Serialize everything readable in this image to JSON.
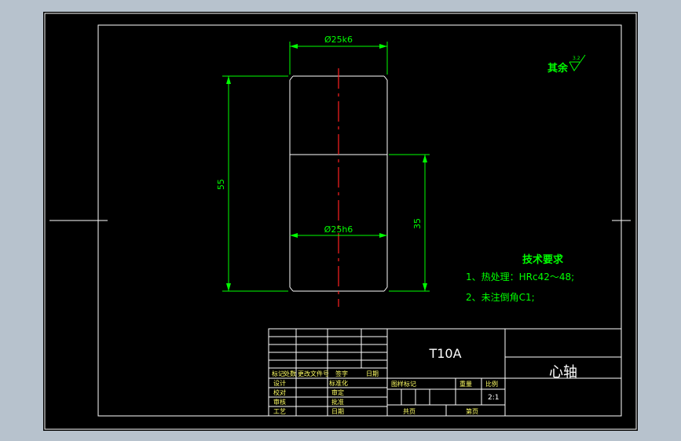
{
  "drawing": {
    "dimensions": {
      "top_diameter": "Ø25k6",
      "bottom_diameter": "Ø25h6",
      "overall_length": "55",
      "lower_length": "35"
    },
    "surface_finish": {
      "label": "其余",
      "value": "3.2"
    },
    "technical_requirements": {
      "title": "技术要求",
      "items": [
        "1、热处理：HRc42～48;",
        "2、未注倒角C1;"
      ]
    },
    "title_block": {
      "material": "T10A",
      "part_name": "心轴",
      "scale": "2:1",
      "labels": {
        "mark": "标记",
        "zones": "处数",
        "change_doc": "更改文件号",
        "signature": "签字",
        "date": "日期",
        "design": "设计",
        "standardize": "标准化",
        "proofread": "校对",
        "review": "审定",
        "audit": "审核",
        "approve": "批准",
        "process": "工艺",
        "date2": "日期",
        "stage_mark": "图样标记",
        "weight": "重量",
        "scale_label": "比例",
        "total_sheets": "共页",
        "sheet_no": "第页"
      }
    }
  }
}
